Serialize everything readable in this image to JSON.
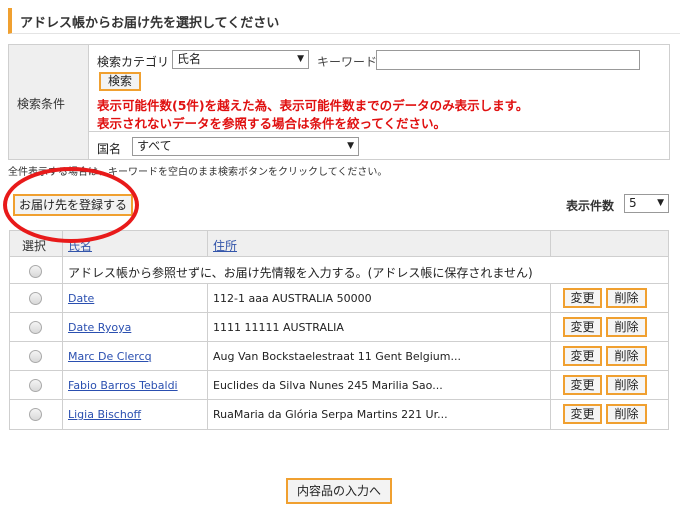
{
  "header": {
    "title": "アドレス帳からお届け先を選択してください"
  },
  "search": {
    "condition_label": "検索条件",
    "category_label": "検索カテゴリ",
    "category_value": "氏名",
    "keyword_label": "キーワード",
    "keyword_value": "",
    "search_button": "検索",
    "warning_line1": "表示可能件数(5件)を越えた為、表示可能件数までのデータのみ表示します。",
    "warning_line2": "表示されないデータを参照する場合は条件を絞ってください。",
    "country_label": "国名",
    "country_value": "すべて",
    "caret": "▼"
  },
  "note": "全件表示する場合は、キーワードを空白のまま検索ボタンをクリックしてください。",
  "register_button": "お届け先を登録する",
  "display_count": {
    "label": "表示件数",
    "value": "5"
  },
  "table": {
    "headers": {
      "select": "選択",
      "name": "氏名",
      "address": "住所"
    },
    "free_entry_text": "アドレス帳から参照せずに、お届け先情報を入力する。(アドレス帳に保存されません)",
    "edit_label": "変更",
    "delete_label": "削除",
    "rows": [
      {
        "name": "Date",
        "address": "112-1 aaa AUSTRALIA 50000"
      },
      {
        "name": "Date Ryoya",
        "address": "1111 11111 AUSTRALIA"
      },
      {
        "name": "Marc De Clercq",
        "address": "Aug Van Bockstaelestraat 11 Gent Belgium..."
      },
      {
        "name": "Fabio Barros Tebaldi",
        "address": "Euclides da Silva Nunes 245 Marilia Sao..."
      },
      {
        "name": "Ligia Bischoff",
        "address": "RuaMaria da Glória Serpa Martins 221 Ur..."
      }
    ]
  },
  "next_button": "内容品の入力へ",
  "colors": {
    "accent": "#f0a030",
    "warning": "#e01010",
    "annotation_circle": "#e81a1a"
  }
}
